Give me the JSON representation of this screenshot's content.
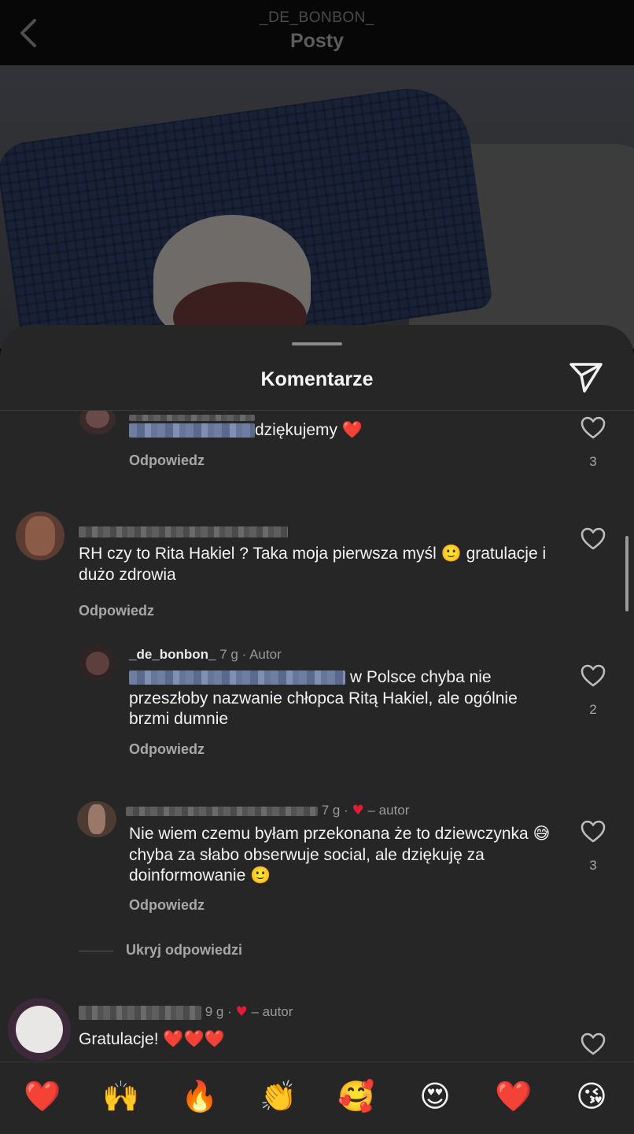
{
  "header": {
    "username": "_DE_BONBON_",
    "title": "Posty"
  },
  "sheet": {
    "title": "Komentarze"
  },
  "comments": [
    {
      "text_tail": "dziękujemy",
      "emoji": "❤️",
      "reply_label": "Odpowiedz",
      "likes": "3"
    },
    {
      "text": "RH czy to Rita Hakiel ? Taka moja pierwsza myśl 🙂 gratulacje i dużo zdrowia",
      "reply_label": "Odpowiedz"
    },
    {
      "username": "_de_bonbon_",
      "time": "7 g",
      "sep": "·",
      "badge": "Autor",
      "text": "w Polsce chyba nie przeszłoby nazwanie chłopca Ritą Hakiel, ale ogólnie brzmi dumnie",
      "reply_label": "Odpowiedz",
      "likes": "2"
    },
    {
      "time_tail": "7 g",
      "sep": "·",
      "badge": "– autor",
      "text": "Nie wiem czemu byłam przekonana że to dziewczynka 😅 chyba za słabo obserwuje social, ale dziękuję za doinformowanie 🙂",
      "reply_label": "Odpowiedz",
      "likes": "3"
    },
    {
      "hide_replies": "Ukryj odpowiedzi"
    },
    {
      "time_tail": "9 g",
      "sep": "·",
      "badge": "– autor",
      "text": "Gratulacje!",
      "emoji": "❤️❤️❤️"
    }
  ],
  "emoji_bar": [
    "❤️",
    "🙌",
    "🔥",
    "👏",
    "🥰",
    "😍",
    "❤️",
    "😘"
  ],
  "colors": {
    "background": "#262626",
    "heart": "#e31b34",
    "muted": "#a7a7a7"
  }
}
